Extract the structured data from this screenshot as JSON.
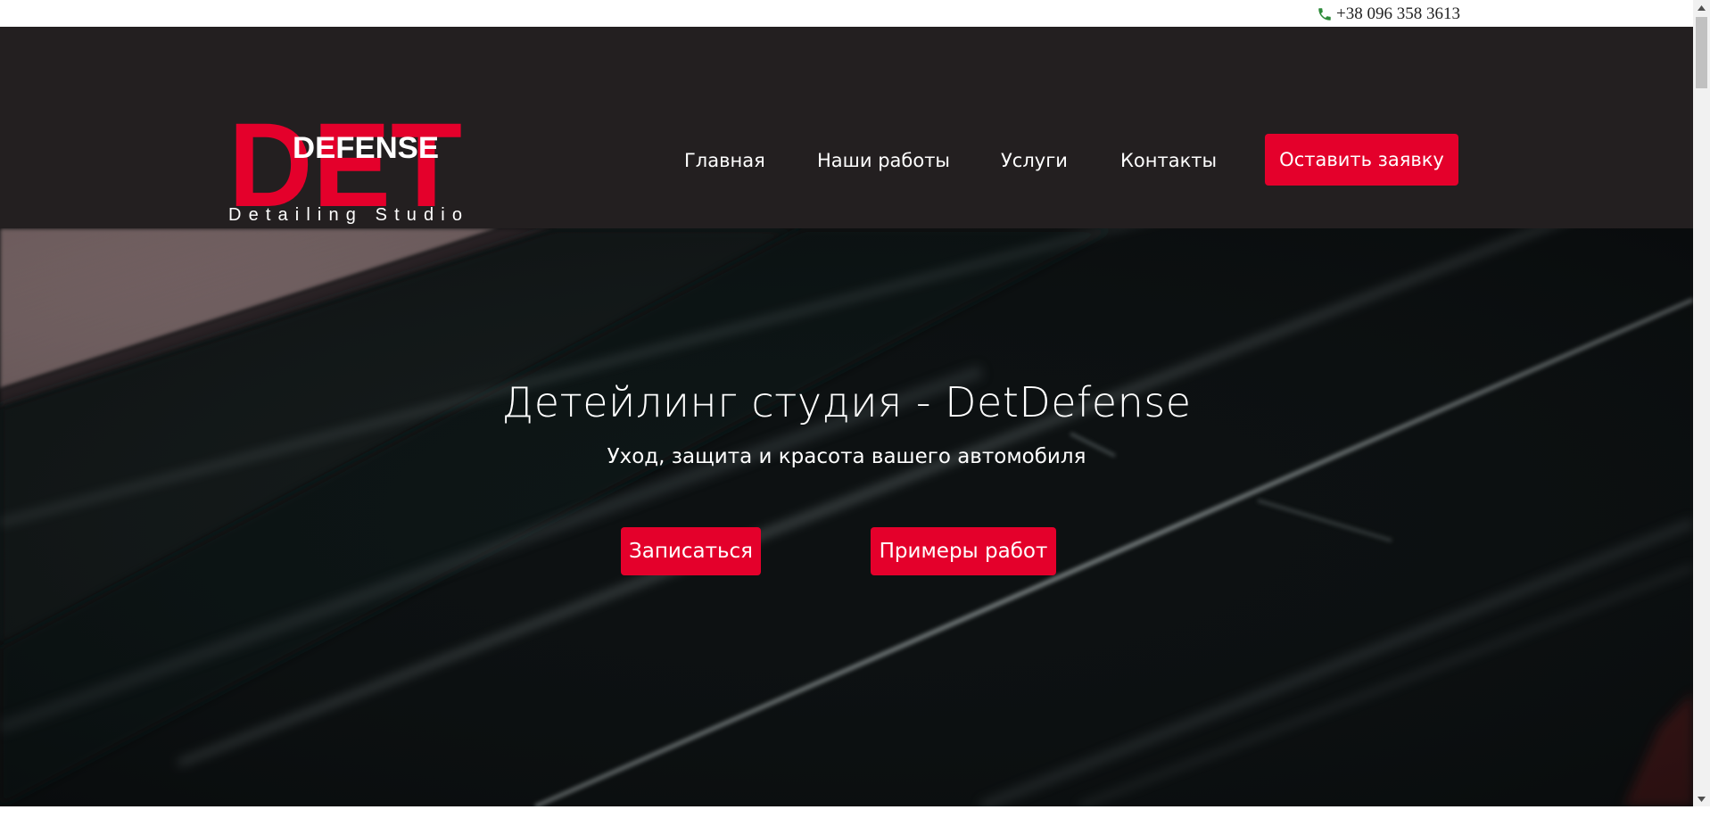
{
  "topbar": {
    "phone": "+38 096 358 3613",
    "phone_icon": "phone-icon"
  },
  "logo": {
    "big_letters": "DET",
    "word": "DEFENSE",
    "tagline": "Detailing Studio"
  },
  "nav": {
    "items": [
      {
        "label": "Главная"
      },
      {
        "label": "Наши работы"
      },
      {
        "label": "Услуги"
      },
      {
        "label": "Контакты"
      }
    ],
    "cta_label": "Оставить заявку"
  },
  "hero": {
    "title": "Детейлинг студия - DetDefense",
    "subtitle": "Уход, защита и красота вашего автомобиля",
    "primary_button": "Записаться",
    "secondary_button": "Примеры работ"
  },
  "colors": {
    "brand_red": "#e4002b",
    "header_bg": "#231f20",
    "hero_bg": "#0e1213",
    "phone_icon": "#2e8b3a"
  }
}
